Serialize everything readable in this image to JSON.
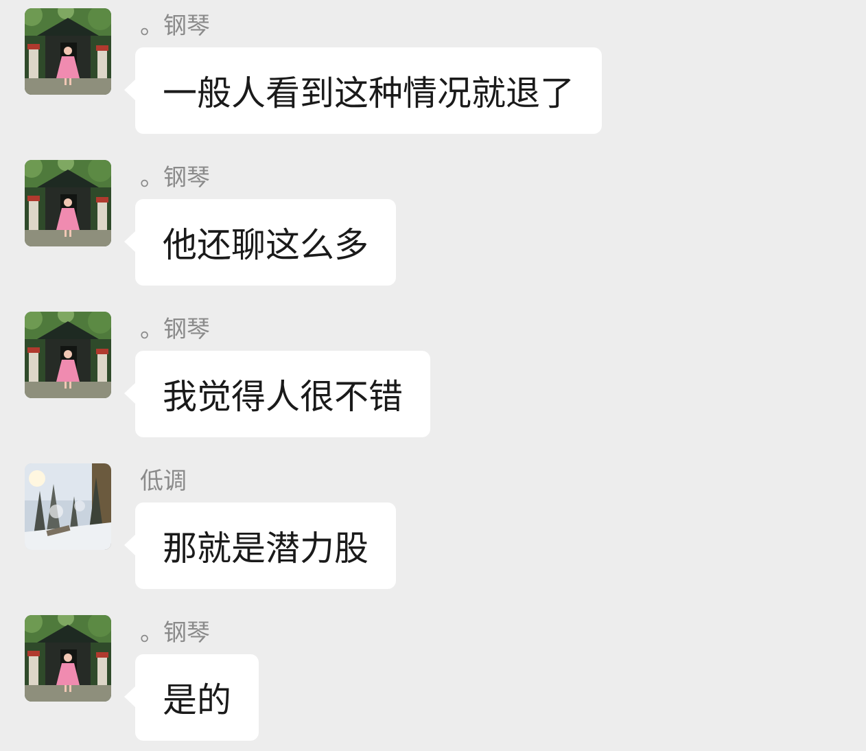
{
  "messages": [
    {
      "sender": "。钢琴",
      "avatar": "piano-avatar",
      "text": "一般人看到这种情况就退了"
    },
    {
      "sender": "。钢琴",
      "avatar": "piano-avatar",
      "text": "他还聊这么多"
    },
    {
      "sender": "。钢琴",
      "avatar": "piano-avatar",
      "text": "我觉得人很不错"
    },
    {
      "sender": "低调",
      "avatar": "snow-forest-avatar",
      "text": "那就是潜力股"
    },
    {
      "sender": "。钢琴",
      "avatar": "piano-avatar",
      "text": "是的"
    }
  ],
  "colors": {
    "background": "#ededed",
    "bubble": "#ffffff",
    "sender_text": "#8a8a8a",
    "message_text": "#1a1a1a"
  }
}
